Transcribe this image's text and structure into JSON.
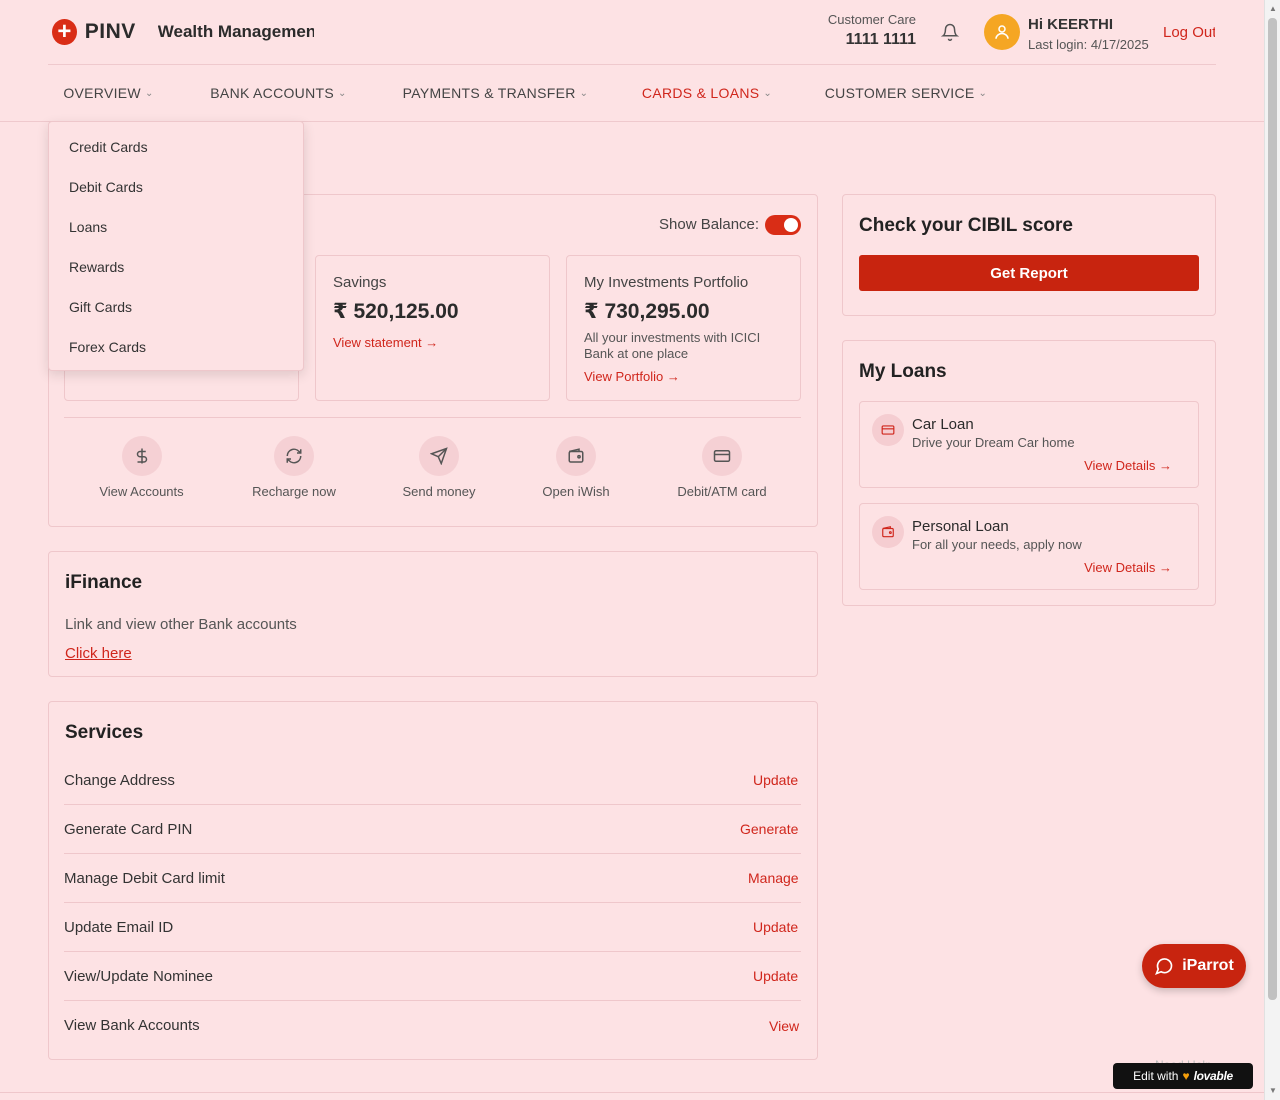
{
  "header": {
    "logo_name": "PINV",
    "logo_tagline": "Wealth Management",
    "customer_care_label": "Customer Care",
    "customer_care_number": "1111 1111",
    "greeting": "Hi KEERTHI",
    "last_login": "Last login: 4/17/2025",
    "logout_label": "Log Out"
  },
  "nav": {
    "items": [
      {
        "label": "OVERVIEW"
      },
      {
        "label": "BANK ACCOUNTS"
      },
      {
        "label": "PAYMENTS & TRANSFER"
      },
      {
        "label": "CARDS & LOANS"
      },
      {
        "label": "CUSTOMER SERVICE"
      }
    ],
    "active": "CARDS & LOANS"
  },
  "dropdown": {
    "items": [
      "Credit Cards",
      "Debit Cards",
      "Loans",
      "Rewards",
      "Gift Cards",
      "Forex Cards"
    ]
  },
  "accounts": {
    "show_balance_label": "Show Balance:",
    "show_balance_on": true,
    "savings": {
      "title": "Savings",
      "amount": "₹ 520,125.00",
      "link": "View statement"
    },
    "investments": {
      "title": "My Investments Portfolio",
      "amount": "₹ 730,295.00",
      "description": "All your investments with ICICI Bank at one place",
      "link": "View Portfolio"
    }
  },
  "quick_actions": [
    {
      "label": "View Accounts",
      "icon": "dollar-icon"
    },
    {
      "label": "Recharge now",
      "icon": "refresh-icon"
    },
    {
      "label": "Send money",
      "icon": "send-icon"
    },
    {
      "label": "Open iWish",
      "icon": "wallet-icon"
    },
    {
      "label": "Debit/ATM card",
      "icon": "card-icon"
    }
  ],
  "ifinance": {
    "title": "iFinance",
    "description": "Link and view other Bank accounts",
    "link": "Click here"
  },
  "services": {
    "title": "Services",
    "rows": [
      {
        "label": "Change Address",
        "action": "Update"
      },
      {
        "label": "Generate Card PIN",
        "action": "Generate"
      },
      {
        "label": "Manage Debit Card limit",
        "action": "Manage"
      },
      {
        "label": "Update Email ID",
        "action": "Update"
      },
      {
        "label": "View/Update Nominee",
        "action": "Update"
      },
      {
        "label": "View Bank Accounts",
        "action": "View"
      }
    ]
  },
  "cibil": {
    "title": "Check your CIBIL score",
    "button": "Get Report"
  },
  "loans": {
    "title": "My Loans",
    "items": [
      {
        "title": "Car Loan",
        "subtitle": "Drive your Dream Car home",
        "link": "View Details",
        "icon": "credit-card-icon"
      },
      {
        "title": "Personal Loan",
        "subtitle": "For all your needs, apply now",
        "link": "View Details",
        "icon": "wallet-icon"
      }
    ]
  },
  "chat": {
    "label": "iParrot"
  },
  "badge": {
    "prefix": "Edit with",
    "brand": "lovable",
    "hint": "Need Help"
  },
  "colors": {
    "accent": "#d0261c",
    "background": "#fde2e4",
    "toggle_on": "#d92d16",
    "avatar": "#f5a623"
  }
}
